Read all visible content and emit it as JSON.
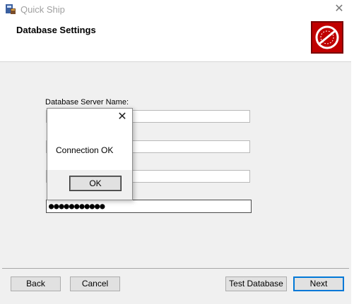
{
  "window": {
    "title": "Quick Ship",
    "close_glyph": "✕",
    "icon": "installer-icon"
  },
  "banner": {
    "title": "Database Settings",
    "logo_icon": "quick-ship-logo-icon"
  },
  "form": {
    "server_label": "Database Server Name:",
    "password_value": "●●●●●●●●●●●"
  },
  "dialog": {
    "message": "Connection OK",
    "ok_label": "OK",
    "close_glyph": "✕"
  },
  "buttons": {
    "back": "Back",
    "cancel": "Cancel",
    "test": "Test Database",
    "next": "Next"
  },
  "colors": {
    "logo_red": "#c00000",
    "primary_border": "#0078d7"
  }
}
